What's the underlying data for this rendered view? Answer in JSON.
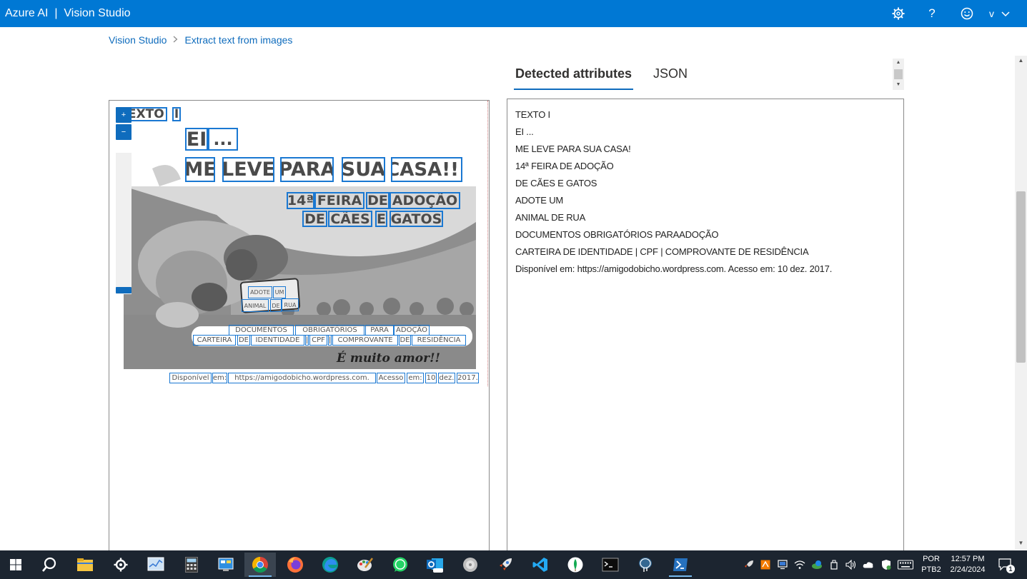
{
  "app": {
    "brand": "Azure AI  |  Vision Studio",
    "user_initial": "v"
  },
  "breadcrumb": {
    "root": "Vision Studio",
    "current": "Extract text from images"
  },
  "tabs": [
    {
      "label": "Detected attributes",
      "active": true
    },
    {
      "label": "JSON",
      "active": false
    }
  ],
  "zoom": {
    "in_label": "+",
    "out_label": "−"
  },
  "ocr_words": [
    {
      "text": "TEXTO"
    },
    {
      "text": "I"
    },
    {
      "text": "EI"
    },
    {
      "text": "..."
    },
    {
      "text": "ME"
    },
    {
      "text": "LEVE"
    },
    {
      "text": "PARA"
    },
    {
      "text": "SUA"
    },
    {
      "text": "CASA!!!"
    },
    {
      "text": "14ª"
    },
    {
      "text": "FEIRA"
    },
    {
      "text": "DE"
    },
    {
      "text": "ADOÇÃO"
    },
    {
      "text": "DE"
    },
    {
      "text": "CÃES"
    },
    {
      "text": "E"
    },
    {
      "text": "GATOS"
    },
    {
      "text": "ADOTE"
    },
    {
      "text": "UM"
    },
    {
      "text": "ANIMAL"
    },
    {
      "text": "DE"
    },
    {
      "text": "RUA"
    },
    {
      "text": "DOCUMENTOS"
    },
    {
      "text": "OBRIGATÓRIOS"
    },
    {
      "text": "PARA"
    },
    {
      "text": "ADOÇÃO"
    },
    {
      "text": "CARTEIRA"
    },
    {
      "text": "DE"
    },
    {
      "text": "IDENTIDADE"
    },
    {
      "text": "|"
    },
    {
      "text": "CPF"
    },
    {
      "text": "|"
    },
    {
      "text": "COMPROVANTE"
    },
    {
      "text": "DE"
    },
    {
      "text": "RESIDÊNCIA"
    },
    {
      "text": "Disponível"
    },
    {
      "text": "em:"
    },
    {
      "text": "https://amigodobicho.wordpress.com."
    },
    {
      "text": "Acesso"
    },
    {
      "text": "em:"
    },
    {
      "text": "10"
    },
    {
      "text": "dez."
    },
    {
      "text": "2017."
    }
  ],
  "poster_script_text": "É muito amor!!",
  "results": [
    "TEXTO I",
    "EI ...",
    "ME LEVE PARA SUA CASA!",
    "14ª FEIRA DE ADOÇÃO",
    "DE CÃES E GATOS",
    "ADOTE UM",
    "ANIMAL DE RUA",
    "DOCUMENTOS OBRIGATÓRIOS PARAADOÇÃO",
    "CARTEIRA DE IDENTIDADE | CPF | COMPROVANTE DE RESIDÊNCIA",
    "Disponível em: https://amigodobicho.wordpress.com. Acesso em: 10 dez. 2017."
  ],
  "icons": {
    "settings": "gear-icon",
    "help": "help-icon",
    "feedback": "smiley-icon",
    "account_menu": "chevron-down-icon"
  },
  "colors": {
    "header": "#0078d4",
    "link": "#0f6cbd",
    "box": "#1a78d2",
    "taskbar": "#1c2530"
  },
  "taskbar": {
    "language": "POR",
    "keyboard": "PTB2",
    "time": "12:57 PM",
    "date": "2/24/2024",
    "notifications": "1"
  }
}
